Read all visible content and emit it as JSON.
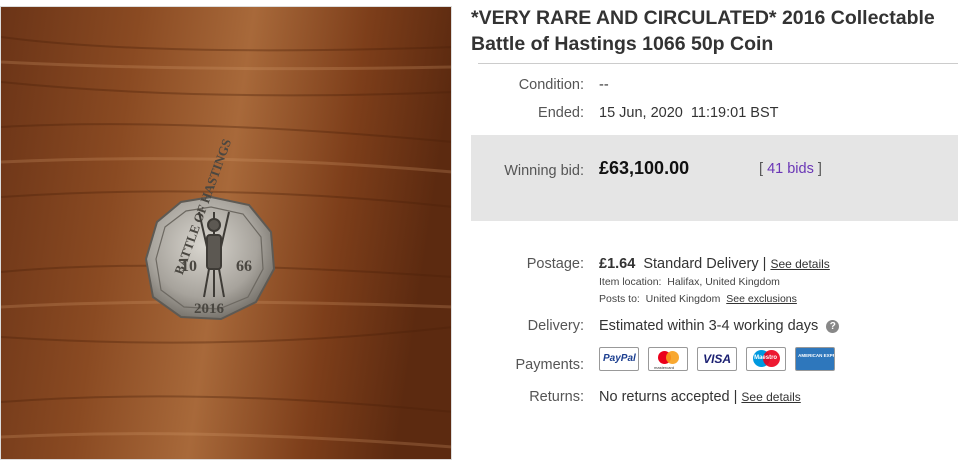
{
  "listing": {
    "title": "*VERY RARE AND CIRCULATED* 2016 Collectable Battle of Hastings 1066 50p Coin",
    "coin_text": {
      "top": "BATTLE OF HASTINGS",
      "year_left": "10",
      "year_right": "66",
      "bottom": "2016"
    }
  },
  "details": {
    "condition_label": "Condition:",
    "condition_value": "--",
    "ended_label": "Ended:",
    "ended_value": "15 Jun, 2020  11:19:01 BST",
    "winning_bid_label": "Winning bid:",
    "winning_bid_value": "£63,100.00",
    "bids_open": "[",
    "bids_link": "41 bids",
    "bids_close": "]",
    "postage_label": "Postage:",
    "postage_price": "£1.64",
    "postage_service": "Standard Delivery |",
    "postage_details_link": "See details",
    "item_location": "Item location:  Halifax, United Kingdom",
    "posts_to": "Posts to:  United Kingdom",
    "see_exclusions": "See exclusions",
    "delivery_label": "Delivery:",
    "delivery_value": "Estimated within 3-4 working days",
    "help_glyph": "?",
    "payments_label": "Payments:",
    "payment_methods": {
      "paypal": "PayPal",
      "mastercard": "mastercard",
      "visa": "VISA",
      "maestro": "Maestro",
      "amex": "AMERICAN EXPRESS"
    },
    "returns_label": "Returns:",
    "returns_value": "No returns accepted |",
    "returns_details_link": "See details"
  },
  "colors": {
    "link": "#6a36b6",
    "bid_box": "#e5e5e5",
    "wood_dark": "#5a2a10",
    "wood_light": "#9a5a2c"
  }
}
